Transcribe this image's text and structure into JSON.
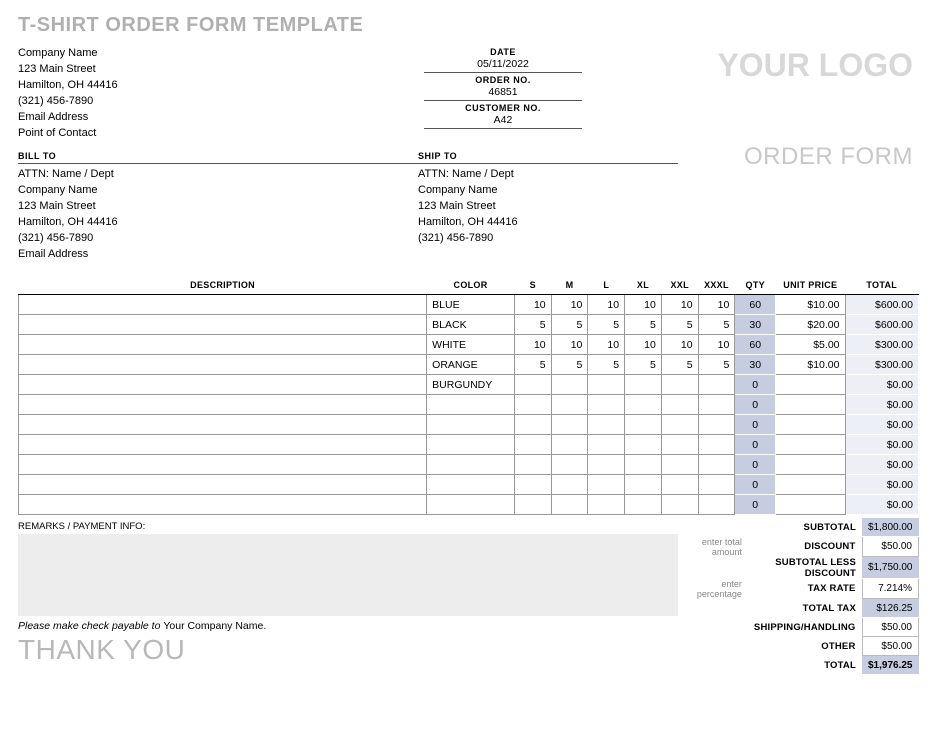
{
  "page_title": "T-SHIRT ORDER FORM TEMPLATE",
  "logo_text": "YOUR LOGO",
  "order_form_label": "ORDER FORM",
  "company": {
    "name": "Company Name",
    "street": "123 Main Street",
    "city": "Hamilton, OH 44416",
    "phone": "(321) 456-7890",
    "email": "Email Address",
    "contact": "Point of Contact"
  },
  "meta": {
    "date_label": "DATE",
    "date": "05/11/2022",
    "order_no_label": "ORDER NO.",
    "order_no": "46851",
    "customer_no_label": "CUSTOMER NO.",
    "customer_no": "A42"
  },
  "bill_to": {
    "header": "BILL TO",
    "attn": "ATTN: Name / Dept",
    "company": "Company Name",
    "street": "123 Main Street",
    "city": "Hamilton, OH 44416",
    "phone": "(321) 456-7890",
    "email": "Email Address"
  },
  "ship_to": {
    "header": "SHIP TO",
    "attn": "ATTN: Name / Dept",
    "company": "Company Name",
    "street": "123 Main Street",
    "city": "Hamilton, OH 44416",
    "phone": "(321) 456-7890"
  },
  "columns": {
    "description": "DESCRIPTION",
    "color": "COLOR",
    "s": "S",
    "m": "M",
    "l": "L",
    "xl": "XL",
    "xxl": "XXL",
    "xxxl": "XXXL",
    "qty": "QTY",
    "unit_price": "UNIT PRICE",
    "total": "TOTAL"
  },
  "rows": [
    {
      "description": "",
      "color": "BLUE",
      "s": "10",
      "m": "10",
      "l": "10",
      "xl": "10",
      "xxl": "10",
      "xxxl": "10",
      "qty": "60",
      "price": "$10.00",
      "total": "$600.00"
    },
    {
      "description": "",
      "color": "BLACK",
      "s": "5",
      "m": "5",
      "l": "5",
      "xl": "5",
      "xxl": "5",
      "xxxl": "5",
      "qty": "30",
      "price": "$20.00",
      "total": "$600.00"
    },
    {
      "description": "",
      "color": "WHITE",
      "s": "10",
      "m": "10",
      "l": "10",
      "xl": "10",
      "xxl": "10",
      "xxxl": "10",
      "qty": "60",
      "price": "$5.00",
      "total": "$300.00"
    },
    {
      "description": "",
      "color": "ORANGE",
      "s": "5",
      "m": "5",
      "l": "5",
      "xl": "5",
      "xxl": "5",
      "xxxl": "5",
      "qty": "30",
      "price": "$10.00",
      "total": "$300.00"
    },
    {
      "description": "",
      "color": "BURGUNDY",
      "s": "",
      "m": "",
      "l": "",
      "xl": "",
      "xxl": "",
      "xxxl": "",
      "qty": "0",
      "price": "",
      "total": "$0.00"
    },
    {
      "description": "",
      "color": "",
      "s": "",
      "m": "",
      "l": "",
      "xl": "",
      "xxl": "",
      "xxxl": "",
      "qty": "0",
      "price": "",
      "total": "$0.00"
    },
    {
      "description": "",
      "color": "",
      "s": "",
      "m": "",
      "l": "",
      "xl": "",
      "xxl": "",
      "xxxl": "",
      "qty": "0",
      "price": "",
      "total": "$0.00"
    },
    {
      "description": "",
      "color": "",
      "s": "",
      "m": "",
      "l": "",
      "xl": "",
      "xxl": "",
      "xxxl": "",
      "qty": "0",
      "price": "",
      "total": "$0.00"
    },
    {
      "description": "",
      "color": "",
      "s": "",
      "m": "",
      "l": "",
      "xl": "",
      "xxl": "",
      "xxxl": "",
      "qty": "0",
      "price": "",
      "total": "$0.00"
    },
    {
      "description": "",
      "color": "",
      "s": "",
      "m": "",
      "l": "",
      "xl": "",
      "xxl": "",
      "xxxl": "",
      "qty": "0",
      "price": "",
      "total": "$0.00"
    },
    {
      "description": "",
      "color": "",
      "s": "",
      "m": "",
      "l": "",
      "xl": "",
      "xxl": "",
      "xxxl": "",
      "qty": "0",
      "price": "",
      "total": "$0.00"
    }
  ],
  "remarks_label": "REMARKS / PAYMENT INFO:",
  "payable_prefix": "Please make check payable to ",
  "payable_company": "Your Company Name.",
  "thank_you": "THANK YOU",
  "totals": {
    "subtotal": {
      "label": "SUBTOTAL",
      "value": "$1,800.00"
    },
    "discount": {
      "hint": "enter total amount",
      "label": "DISCOUNT",
      "value": "$50.00"
    },
    "less": {
      "label": "SUBTOTAL LESS DISCOUNT",
      "value": "$1,750.00"
    },
    "tax_rate": {
      "hint": "enter percentage",
      "label": "TAX RATE",
      "value": "7.214%"
    },
    "total_tax": {
      "label": "TOTAL TAX",
      "value": "$126.25"
    },
    "shipping": {
      "label": "SHIPPING/HANDLING",
      "value": "$50.00"
    },
    "other": {
      "label": "OTHER",
      "value": "$50.00"
    },
    "grand": {
      "label": "TOTAL",
      "value": "$1,976.25"
    }
  }
}
